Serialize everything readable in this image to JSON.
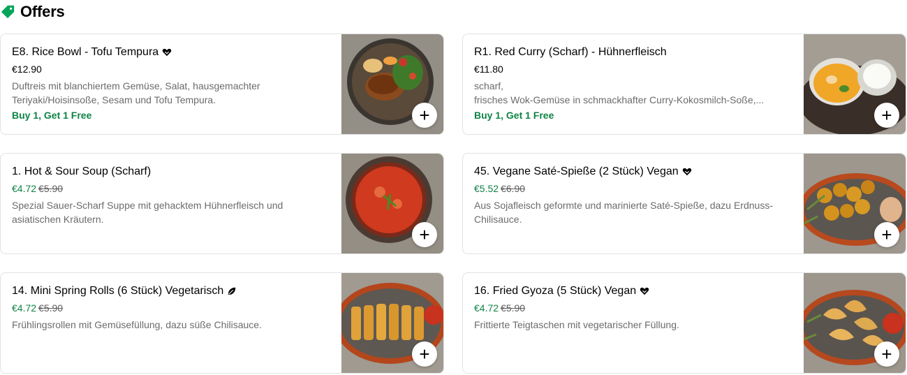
{
  "section": {
    "title": "Offers",
    "icon": "tag-icon",
    "accent": "#06a45b"
  },
  "colors": {
    "promo_green": "#0e8345",
    "text_muted": "#6b6b6b",
    "border": "#e2e2e2"
  },
  "items": [
    {
      "name": "E8. Rice Bowl - Tofu Tempura",
      "badge": "heart-icon",
      "price": "€12.90",
      "old_price": "",
      "desc_lines": [
        "Duftreis mit blanchiertem Gemüse, Salat, hausgemachter",
        "Teriyaki/Hoisinsoße, Sesam und Tofu Tempura."
      ],
      "offer": "Buy 1, Get 1 Free",
      "image": "rice-bowl-photo",
      "add_label": "+"
    },
    {
      "name": "R1. Red Curry (Scharf) - Hühnerfleisch",
      "badge": "",
      "price": "€11.80",
      "old_price": "",
      "desc_lines": [
        "scharf,",
        "frisches Wok-Gemüse in schmackhafter Curry-Kokosmilch-Soße,..."
      ],
      "offer": "Buy 1, Get 1 Free",
      "image": "red-curry-photo",
      "add_label": "+"
    },
    {
      "name": "1. Hot & Sour Soup (Scharf)",
      "badge": "",
      "price": "€4.72",
      "old_price": "€5.90",
      "desc_lines": [
        "Spezial Sauer-Scharf Suppe mit gehacktem Hühnerfleisch und",
        "asiatischen Kräutern."
      ],
      "offer": "",
      "image": "hot-sour-soup-photo",
      "add_label": "+"
    },
    {
      "name": "45. Vegane Saté-Spieße (2 Stück) Vegan",
      "badge": "heart-icon",
      "price": "€5.52",
      "old_price": "€6.90",
      "desc_lines": [
        "Aus Sojafleisch geformte und marinierte Saté-Spieße, dazu Erdnuss-",
        "Chilisauce."
      ],
      "offer": "",
      "image": "sate-skewers-photo",
      "add_label": "+"
    },
    {
      "name": "14. Mini Spring Rolls (6 Stück) Vegetarisch",
      "badge": "leaf-icon",
      "price": "€4.72",
      "old_price": "€5.90",
      "desc_lines": [
        "Frühlingsrollen mit Gemüsefüllung, dazu süße Chilisauce."
      ],
      "offer": "",
      "image": "spring-rolls-photo",
      "add_label": "+"
    },
    {
      "name": "16. Fried Gyoza (5 Stück) Vegan",
      "badge": "heart-icon",
      "price": "€4.72",
      "old_price": "€5.90",
      "desc_lines": [
        "Frittierte Teigtaschen mit vegetarischer Füllung."
      ],
      "offer": "",
      "image": "gyoza-photo",
      "add_label": "+"
    }
  ]
}
